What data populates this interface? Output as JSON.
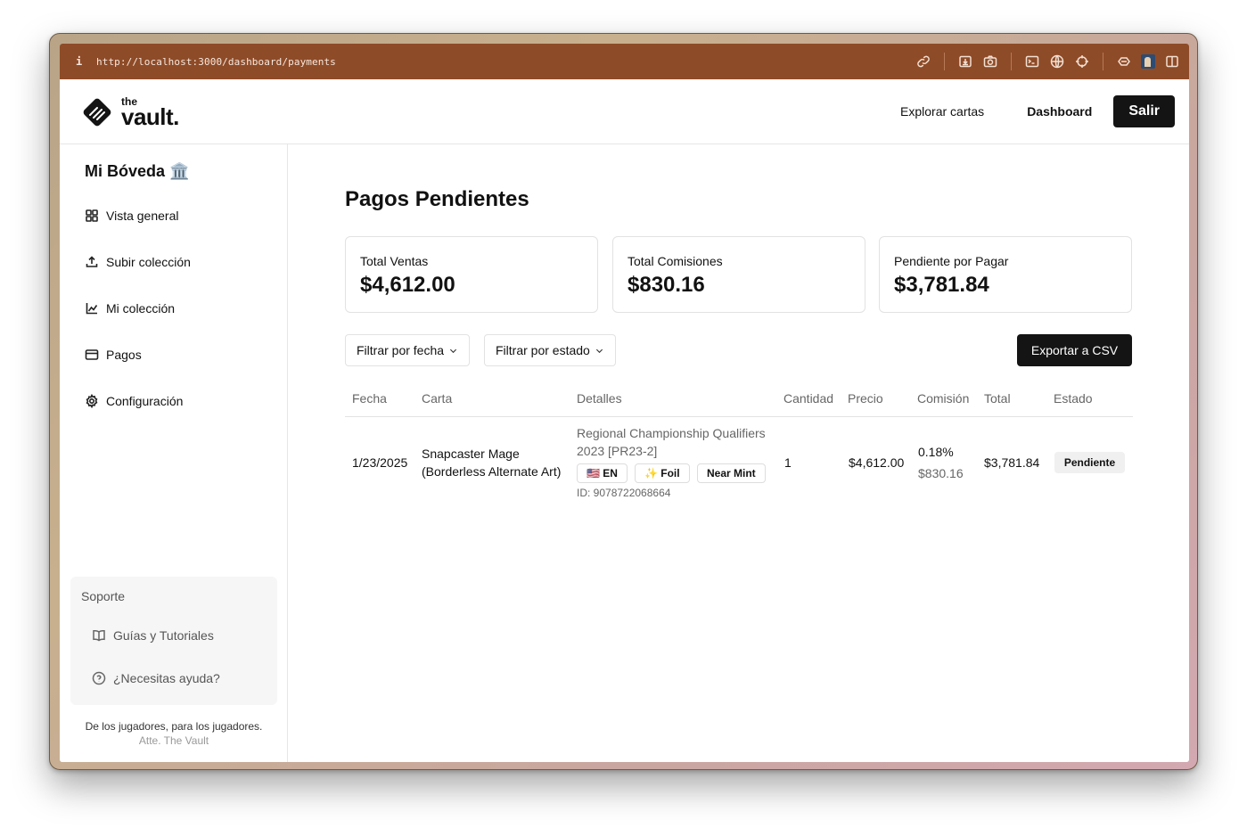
{
  "browser": {
    "info_icon": "i",
    "url": "http://localhost:3000/dashboard/payments",
    "icons": [
      "link-icon",
      "download-icon",
      "camera-icon",
      "terminal-icon",
      "globe-icon",
      "crosshair-icon",
      "extensions-icon",
      "profile-icon",
      "sidebar-icon"
    ]
  },
  "header": {
    "logo_small": "the",
    "logo_large": "vault.",
    "nav_explore": "Explorar cartas",
    "nav_dashboard": "Dashboard",
    "logout": "Salir"
  },
  "sidebar": {
    "title": "Mi Bóveda 🏛️",
    "items": [
      {
        "label": "Vista general",
        "icon": "grid-icon"
      },
      {
        "label": "Subir colección",
        "icon": "upload-icon"
      },
      {
        "label": "Mi colección",
        "icon": "chart-icon"
      },
      {
        "label": "Pagos",
        "icon": "credit-card-icon"
      },
      {
        "label": "Configuración",
        "icon": "gear-icon"
      }
    ],
    "support": {
      "title": "Soporte",
      "items": [
        {
          "label": "Guías y Tutoriales",
          "icon": "book-icon"
        },
        {
          "label": "¿Necesitas ayuda?",
          "icon": "help-circle-icon"
        }
      ]
    },
    "footer_line1": "De los jugadores, para los jugadores.",
    "footer_line2": "Atte. The Vault"
  },
  "main": {
    "title": "Pagos Pendientes",
    "cards": [
      {
        "label": "Total Ventas",
        "value": "$4,612.00"
      },
      {
        "label": "Total Comisiones",
        "value": "$830.16"
      },
      {
        "label": "Pendiente por Pagar",
        "value": "$3,781.84"
      }
    ],
    "filter_date": "Filtrar por fecha",
    "filter_status": "Filtrar por estado",
    "export": "Exportar a CSV",
    "columns": [
      "Fecha",
      "Carta",
      "Detalles",
      "Cantidad",
      "Precio",
      "Comisión",
      "Total",
      "Estado"
    ],
    "rows": [
      {
        "fecha": "1/23/2025",
        "carta_line1": "Snapcaster Mage",
        "carta_line2": "(Borderless Alternate Art)",
        "set_line1": "Regional Championship Qualifiers",
        "set_line2": "2023 [PR23-2]",
        "lang_badge": "🇺🇸 EN",
        "foil_badge": "✨ Foil",
        "condition_badge": "Near Mint",
        "id": "ID: 9078722068664",
        "cantidad": "1",
        "precio": "$4,612.00",
        "comision_pct": "0.18%",
        "comision_amt": "$830.16",
        "total": "$3,781.84",
        "estado": "Pendiente"
      }
    ]
  }
}
